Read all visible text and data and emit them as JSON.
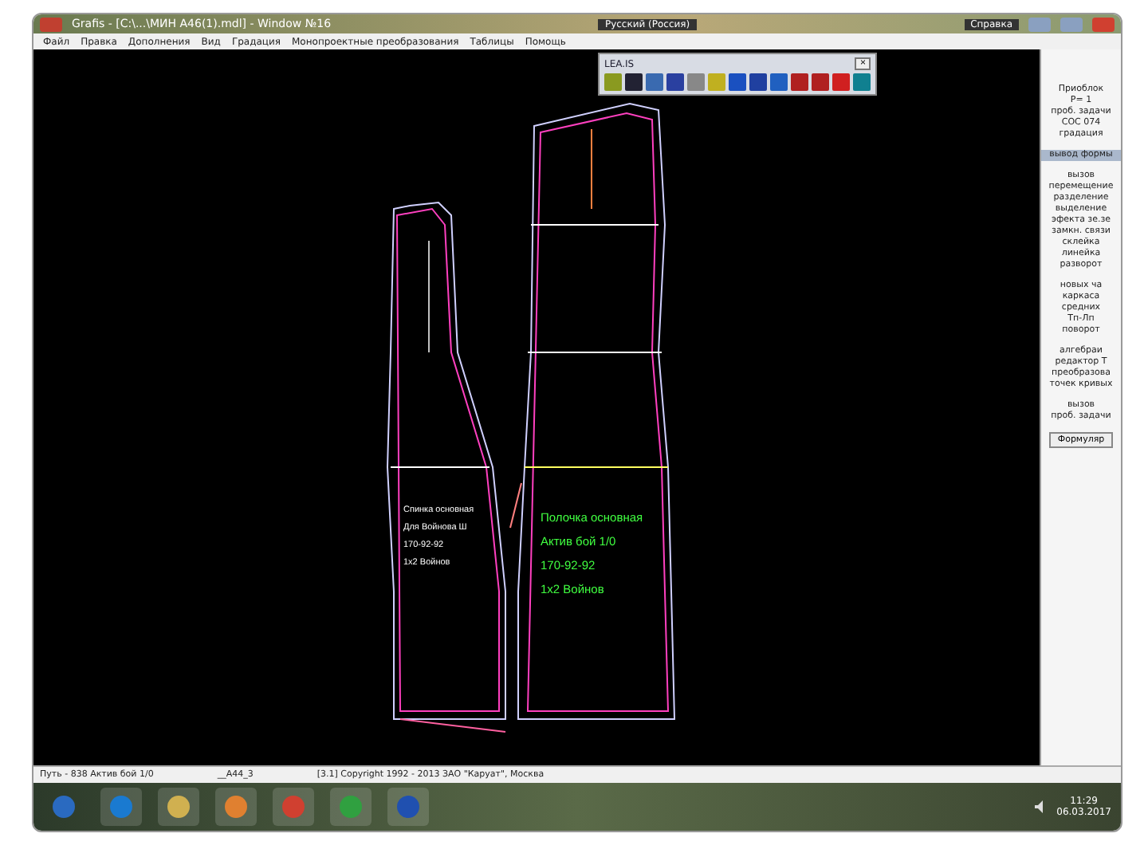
{
  "window": {
    "title": "Grafis - [C:\\...\\МИН А46(1).mdl] - Window №16",
    "language": "Русский (Россия)",
    "help": "Справка"
  },
  "menu": [
    "Файл",
    "Правка",
    "Дополнения",
    "Вид",
    "Градация",
    "Монопроектные преобразования",
    "Таблицы",
    "Помощь"
  ],
  "toolbox": {
    "title": "LEA.IS",
    "close": "×"
  },
  "canvas": {
    "left_label": [
      "Спинка основная",
      "Для Войнова Ш",
      "170-92-92",
      "1х2 Войнов"
    ],
    "right_label": [
      "Полочка основная",
      "Актив бой 1/0",
      "170-92-92",
      "1х2 Войнов"
    ]
  },
  "side_panel": {
    "blocks": [
      {
        "lines": [
          "Приоблок",
          "Р= 1",
          "проб. задачи",
          "СОС 074",
          "градация"
        ],
        "selected": false
      },
      {
        "lines": [
          "вывод формы"
        ],
        "selected": true
      },
      {
        "lines": [
          "вызов",
          "перемещение",
          "разделение",
          "выделение",
          "эфекта зе.зе",
          "замкн. связи",
          "склейка",
          "линейка",
          "разворот"
        ],
        "selected": false
      },
      {
        "lines": [
          "новых ча",
          "каркаса",
          "средних",
          "Тп-Лп",
          "поворот"
        ],
        "selected": false
      },
      {
        "lines": [
          "алгебраи",
          "редактор Т",
          "преобразова",
          "точек кривых"
        ],
        "selected": false
      },
      {
        "lines": [
          "вызов",
          "проб. задачи"
        ],
        "selected": false
      }
    ],
    "button": "Формуляр"
  },
  "status_bar": [
    "Путь - 838 Актив бой 1/0",
    "__A44_3",
    "[3.1] Copyright 1992 - 2013 ЗАО \"Каруат\", Москва"
  ],
  "taskbar": {
    "time": "11:29",
    "date": "06.03.2017"
  }
}
